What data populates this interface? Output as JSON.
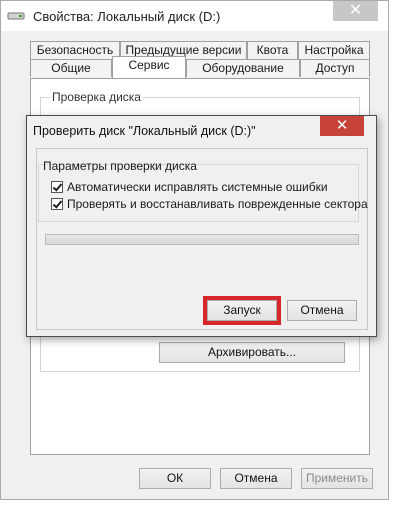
{
  "window": {
    "title": "Свойства: Локальный диск (D:)",
    "close_glyph": "✕"
  },
  "tabs_row1": [
    "Безопасность",
    "Предыдущие версии",
    "Квота",
    "Настройка"
  ],
  "tabs_row2": [
    "Общие",
    "Сервис",
    "Оборудование",
    "Доступ"
  ],
  "active_tab": "Сервис",
  "panel": {
    "group_label": "Проверка диска",
    "archive_button": "Архивировать..."
  },
  "footer": {
    "ok": "ОК",
    "cancel": "Отмена",
    "apply": "Применить"
  },
  "dialog": {
    "title": "Проверить диск \"Локальный диск (D:)\"",
    "close_glyph": "✕",
    "group_label": "Параметры проверки диска",
    "option1": {
      "label": "Автоматически исправлять системные ошибки",
      "checked": true
    },
    "option2": {
      "label": "Проверять и восстанавливать поврежденные сектора",
      "checked": true
    },
    "progress": 0,
    "start_button": "Запуск",
    "cancel_button": "Отмена"
  },
  "colors": {
    "dialog_close": "#c7433a",
    "highlight": "#d6262b"
  }
}
